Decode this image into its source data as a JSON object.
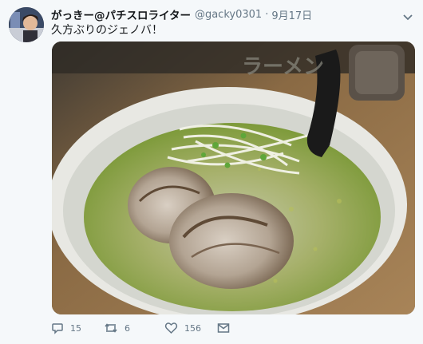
{
  "tweet": {
    "author_name": "がっきー@パチスロライター",
    "handle": "@gacky0301",
    "separator": "·",
    "date": "9月17日",
    "text": "久方ぶりのジェノバ！",
    "photo_alt": "ラーメン",
    "bowl_print": "ラーメン",
    "actions": {
      "reply_count": "15",
      "retweet_count": "6",
      "like_count": "156"
    }
  },
  "colors": {
    "text_primary": "#14171a",
    "text_secondary": "#657786",
    "background": "#f5f8fa"
  },
  "icons": [
    "caret-down-icon",
    "reply-icon",
    "retweet-icon",
    "heart-icon",
    "mail-icon"
  ]
}
